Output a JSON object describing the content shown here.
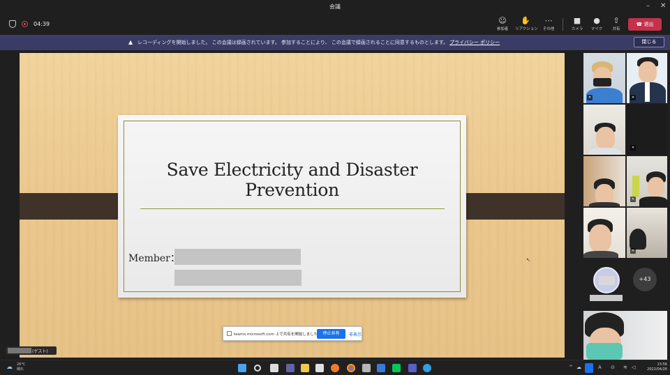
{
  "window": {
    "title": "会議",
    "minimize": "–",
    "close": "✕"
  },
  "toolbar": {
    "timer": "04:39",
    "buttons": [
      {
        "icon": "participants-icon",
        "glyph": "☺",
        "label": "参加者"
      },
      {
        "icon": "reactions-icon",
        "glyph": "✋",
        "label": "リアクション"
      },
      {
        "icon": "more-icon",
        "glyph": "⋯",
        "label": "その他"
      },
      {
        "icon": "camera-icon",
        "glyph": "■",
        "label": "カメラ"
      },
      {
        "icon": "mic-icon",
        "glyph": "●",
        "label": "マイク"
      },
      {
        "icon": "share-icon",
        "glyph": "⇧",
        "label": "共有"
      }
    ],
    "leave_label": "退出"
  },
  "banner": {
    "message": "レコーディングを開始しました。 この会議は録画されています。 参加することにより、 この会議で録画されることに同意するものとします。",
    "link": "プライバシー ポリシー",
    "close_label": "閉じる"
  },
  "slide": {
    "title": "Save Electricity and Disaster Prevention",
    "member_label": "Member："
  },
  "sharebar": {
    "text": "teams.microsoft.com 上で共有を開始しました",
    "stop_label": "停止共有",
    "hide_label": "非表示"
  },
  "self": {
    "suffix": "(ゲスト)"
  },
  "participants": {
    "more_count": "+43"
  },
  "taskbar": {
    "temp": "26°C",
    "weather": "晴れ",
    "time": "13:56",
    "date": "2022/04/26"
  },
  "colors": {
    "leave": "#c4314b",
    "banner": "#3b3c66",
    "accent": "#1a73e8",
    "slide_band": "#3e3229"
  }
}
